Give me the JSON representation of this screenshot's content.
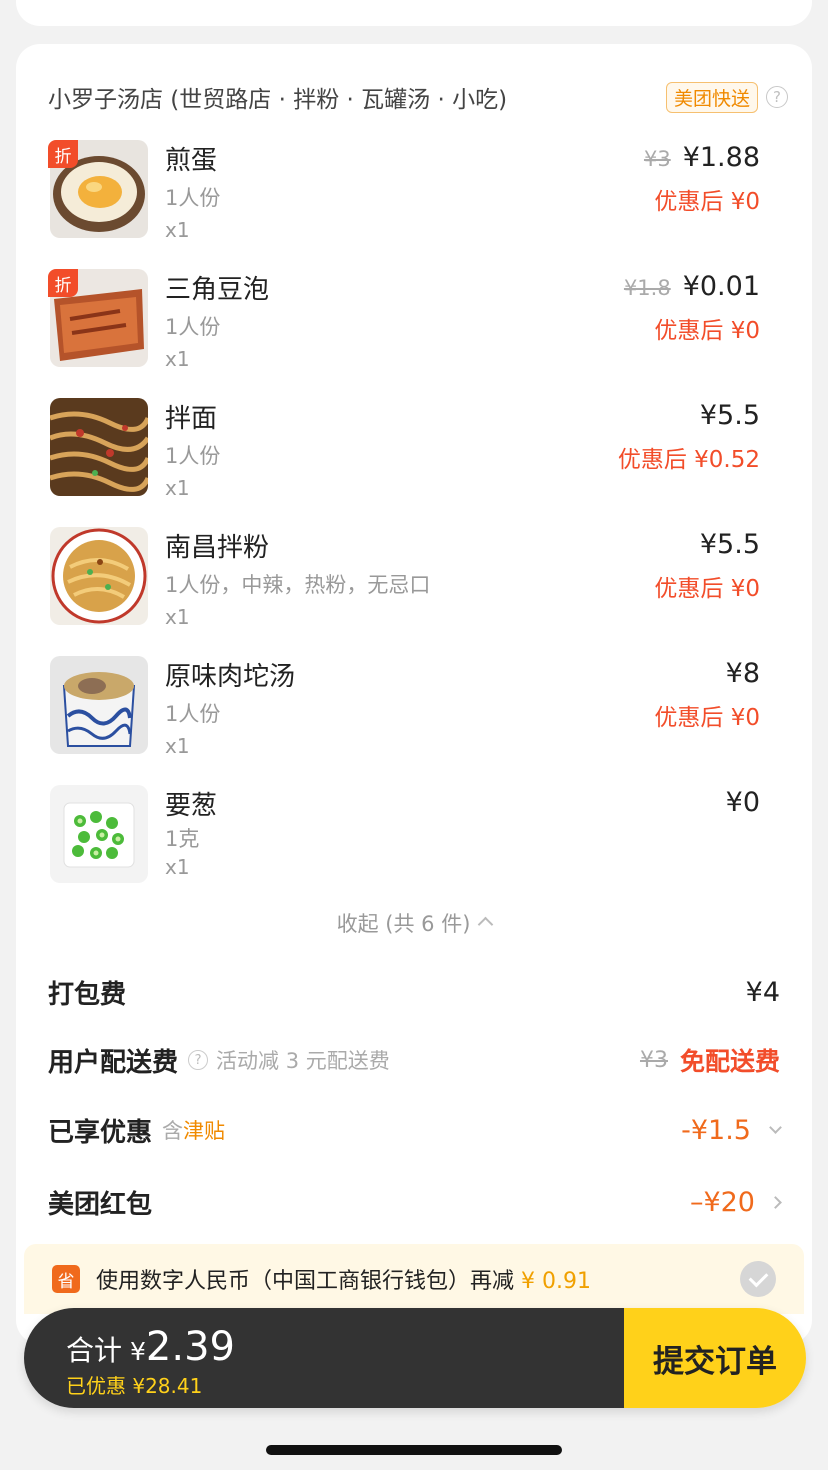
{
  "store": {
    "name": "小罗子汤店 (世贸路店 · 拌粉 · 瓦罐汤 · 小吃)",
    "delivery_tag": "美团快送",
    "help_glyph": "?"
  },
  "items": [
    {
      "name": "煎蛋",
      "spec": "1人份",
      "qty": "x1",
      "discount_badge": "折",
      "original_price": "¥3",
      "price": "¥1.88",
      "after_discount": "优惠后 ¥0"
    },
    {
      "name": "三角豆泡",
      "spec": "1人份",
      "qty": "x1",
      "discount_badge": "折",
      "original_price": "¥1.8",
      "price": "¥0.01",
      "after_discount": "优惠后 ¥0"
    },
    {
      "name": "拌面",
      "spec": "1人份",
      "qty": "x1",
      "price": "¥5.5",
      "after_discount": "优惠后 ¥0.52"
    },
    {
      "name": "南昌拌粉",
      "spec": "1人份，中辣，热粉，无忌口",
      "qty": "x1",
      "price": "¥5.5",
      "after_discount": "优惠后 ¥0"
    },
    {
      "name": "原味肉坨汤",
      "spec": "1人份",
      "qty": "x1",
      "price": "¥8",
      "after_discount": "优惠后 ¥0"
    },
    {
      "name": "要葱",
      "spec": "1克",
      "qty": "x1",
      "price": "¥0"
    }
  ],
  "collapse_label": "收起 (共 6 件)",
  "fees": {
    "packing_label": "打包费",
    "packing_value": "¥4",
    "delivery_label": "用户配送费",
    "delivery_note": "活动减 3 元配送费",
    "delivery_original": "¥3",
    "delivery_value": "免配送费",
    "discount_label": "已享优惠",
    "discount_sub_prefix": "含",
    "discount_sub_highlight": "津贴",
    "discount_value": "-¥1.5",
    "redpacket_label": "美团红包",
    "redpacket_value": "–¥20"
  },
  "ecny": {
    "icon_glyph": "省",
    "text": "使用数字人民币（中国工商银行钱包）再减",
    "amount": "¥ 0.91"
  },
  "checkout": {
    "total_label": "合计",
    "currency": "¥",
    "total_amount": "2.39",
    "saved": "已优惠 ¥28.41",
    "submit_label": "提交订单"
  },
  "colors": {
    "accent_red": "#f24d2a",
    "accent_orange": "#f06a1c",
    "brand_yellow": "#ffd11a",
    "dark_bar": "#333333"
  }
}
